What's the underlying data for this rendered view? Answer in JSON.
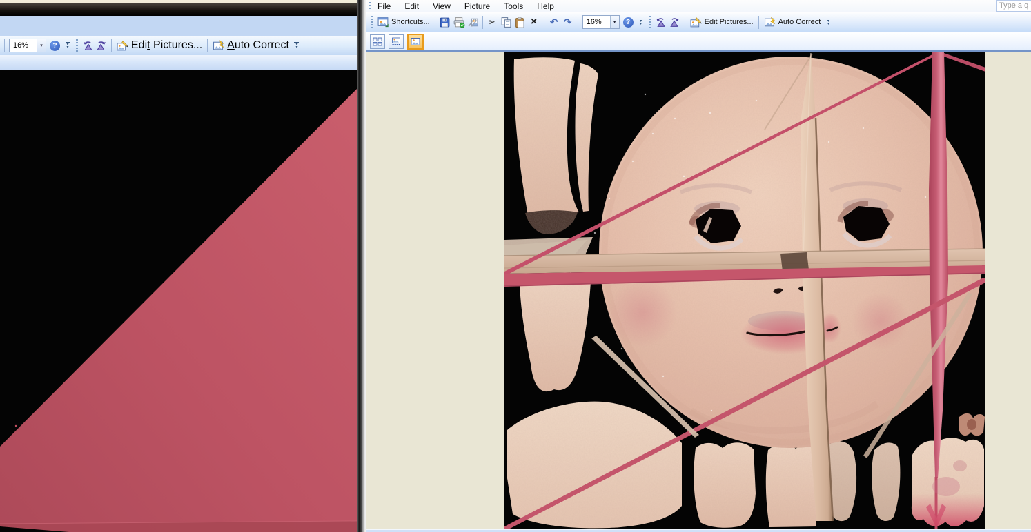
{
  "left_window": {
    "toolbar": {
      "zoom_value": "16%",
      "edit_pictures": {
        "pre": "Edi",
        "accel": "t",
        "post": " Pictures..."
      },
      "auto_correct": {
        "accel": "A",
        "rest": "uto Correct"
      }
    }
  },
  "right_window": {
    "menu": {
      "items": [
        {
          "accel": "F",
          "rest": "ile"
        },
        {
          "accel": "E",
          "rest": "dit"
        },
        {
          "accel": "V",
          "rest": "iew"
        },
        {
          "accel": "P",
          "rest": "icture"
        },
        {
          "accel": "T",
          "rest": "ools"
        },
        {
          "accel": "H",
          "rest": "elp"
        }
      ]
    },
    "search": {
      "placeholder": "Type a q"
    },
    "toolbar": {
      "shortcuts": {
        "accel": "S",
        "rest": "hortcuts..."
      },
      "zoom_value": "16%",
      "edit_pictures": {
        "pre": "Edi",
        "accel": "t",
        "post": " Pictures..."
      },
      "auto_correct": {
        "accel": "A",
        "rest": "uto Correct"
      }
    },
    "view_modes": {
      "selected_index": 2
    }
  },
  "icons": {
    "cut": "✂",
    "delete": "×",
    "undo": "↶",
    "redo": "↷",
    "help": "?",
    "dropdown": "▾"
  },
  "colors": {
    "ribbon_red": "#c2556a",
    "skin": "#e9c6b2",
    "content_bg": "#e9e6d4",
    "toolbar_blue": "#d6e5fa",
    "selected_orange": "#e89b1c",
    "texture_bg": "#040404"
  }
}
